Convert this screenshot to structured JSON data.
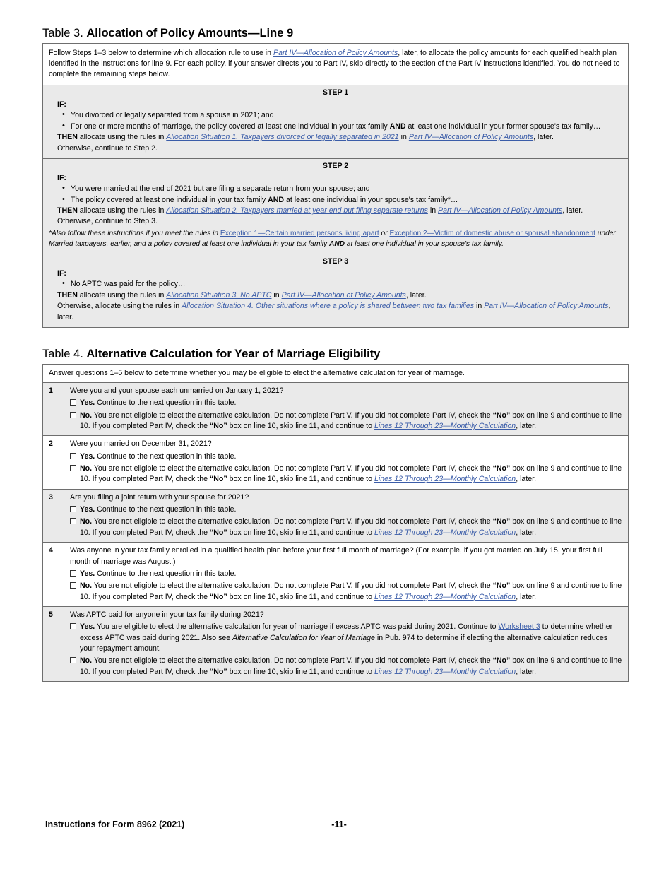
{
  "document": {
    "footer_left": "Instructions for Form 8962 (2021)",
    "page_number": "-11-"
  },
  "colors": {
    "link": "#3a5ca8",
    "shaded_row": "#eaeaea",
    "border": "#6e6e6e",
    "text": "#000000"
  },
  "table3": {
    "caption_label": "Table 3.",
    "caption_title": "Allocation of Policy Amounts—Line 9",
    "intro": {
      "part1": "Follow Steps 1–3 below to determine which allocation rule to use in ",
      "link1": "Part IV—Allocation of Policy Amounts",
      "part2": ", later, to allocate the policy amounts for each qualified health plan identified in the instructions for line 9. For each policy, if your answer directs you to Part IV, skip directly to the section of the Part IV instructions identified. You do not need to complete the remaining steps below."
    },
    "steps": [
      {
        "heading": "STEP 1",
        "if_label": "IF:",
        "bullets": [
          {
            "pre": "You divorced or legally separated from a spouse in 2021; and",
            "bold": "",
            "post": ""
          },
          {
            "pre": "For one or more months of marriage, the policy covered at least one individual in your tax family ",
            "bold": "AND",
            "post": " at least one individual in your former spouse's tax family…"
          }
        ],
        "then_bold": "THEN",
        "then_pre": " allocate using the rules in ",
        "then_link1": "Allocation Situation 1. Taxpayers divorced or legally separated in 2021",
        "then_mid": " in ",
        "then_link2": "Part IV—Allocation of Policy Amounts",
        "then_post": ", later.",
        "otherwise": "Otherwise, continue to Step 2.",
        "footnote": null
      },
      {
        "heading": "STEP 2",
        "if_label": "IF:",
        "bullets": [
          {
            "pre": "You were married at the end of 2021 but are filing a separate return from your spouse; and",
            "bold": "",
            "post": ""
          },
          {
            "pre": "The policy covered at least one individual in your tax family ",
            "bold": "AND",
            "post": " at least one individual in your spouse's tax family*…"
          }
        ],
        "then_bold": "THEN",
        "then_pre": " allocate using the rules in ",
        "then_link1": "Allocation Situation 2. Taxpayers married at year end but filing separate returns",
        "then_mid": " in ",
        "then_link2": "Part IV—Allocation of Policy Amounts",
        "then_post": ", later.",
        "otherwise": "Otherwise, continue to Step 3.",
        "footnote": {
          "pre": "*Also follow these instructions if you meet the rules in ",
          "link1": "Exception 1—Certain married persons living apart",
          "mid": " or ",
          "link2": "Exception 2—Victim of domestic abuse or spousal abandonment",
          "post_a": " under Married taxpayers, ",
          "post_italic": "earlier",
          "post_b": ", and a policy covered at least one individual in your tax family ",
          "post_bold": "AND",
          "post_c": " at least one individual in your spouse's tax family."
        }
      },
      {
        "heading": "STEP 3",
        "if_label": "IF:",
        "bullets": [
          {
            "pre": "No APTC was paid for the policy…",
            "bold": "",
            "post": ""
          }
        ],
        "then_bold": "THEN",
        "then_pre": " allocate using the rules in ",
        "then_link1": "Allocation Situation 3. No APTC",
        "then_mid": " in ",
        "then_link2": "Part IV—Allocation of Policy Amounts",
        "then_post": ", later.",
        "otherwise_pre": "Otherwise, allocate using the rules in ",
        "otherwise_link1": "Allocation Situation 4. Other situations where a policy is shared between two tax families",
        "otherwise_mid": " in ",
        "otherwise_link2": "Part IV—Allocation of Policy Amounts",
        "otherwise_post": ", later.",
        "footnote": null
      }
    ]
  },
  "table4": {
    "caption_label": "Table 4.",
    "caption_title": "Alternative Calculation for Year of Marriage Eligibility",
    "intro": "Answer questions 1–5 below to determine whether you may be eligible to elect the alternative calculation for year of marriage.",
    "no_answer": {
      "bold": "No.",
      "text_a": " You are not eligible to elect the alternative calculation. Do not complete Part V. If you did not complete Part IV, check the ",
      "quote1": "“No”",
      "text_b": " box on line 9 and continue to line 10. If you completed Part IV, check the ",
      "quote2": "“No”",
      "text_c": " box on line 10, skip line 11, and continue to ",
      "link": "Lines 12 Through 23—Monthly Calculation",
      "text_d": ", later."
    },
    "yes_simple": {
      "bold": "Yes.",
      "text": " Continue to the next question in this table."
    },
    "rows": [
      {
        "num": "1",
        "shaded": true,
        "question": "Were you and your spouse each unmarried on January 1, 2021?"
      },
      {
        "num": "2",
        "shaded": false,
        "question": "Were you married on December 31, 2021?"
      },
      {
        "num": "3",
        "shaded": true,
        "question": "Are you filing a joint return with your spouse for 2021?"
      },
      {
        "num": "4",
        "shaded": false,
        "question": "Was anyone in your tax family enrolled in a qualified health plan before your first full month of marriage? (For example, if you got married on July 15, your first full month of marriage was August.)"
      },
      {
        "num": "5",
        "shaded": true,
        "question": "Was APTC paid for anyone in your tax family during 2021?"
      }
    ],
    "row5_yes": {
      "bold": "Yes.",
      "text_a": " You are eligible to elect the alternative calculation for year of marriage if excess APTC was paid during 2021. Continue to ",
      "link": "Worksheet 3",
      "text_b": " to determine whether excess APTC was paid during 2021. Also see ",
      "italic": "Alternative Calculation for Year of Marriage",
      "text_c": " in Pub. 974 to determine if electing the alternative calculation reduces your repayment amount."
    }
  }
}
